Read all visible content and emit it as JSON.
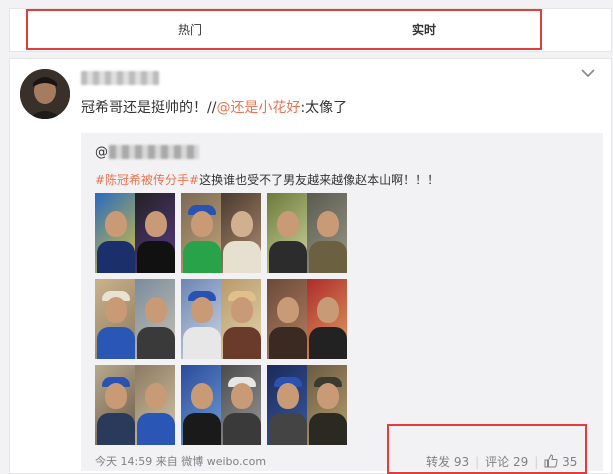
{
  "tabs": [
    {
      "label": "热门",
      "active": false
    },
    {
      "label": "实时",
      "active": true
    }
  ],
  "post": {
    "text_main": "冠希哥还是挺帅的！//",
    "mention": "@还是小花好",
    "text_after": ":太像了",
    "repost": {
      "user_prefix": "@",
      "hashtag": "#陈冠希被传分手#",
      "text": "这换谁也受不了男友越来越像赵本山啊！！！"
    },
    "footer": {
      "time": "今天 14:59",
      "source_prefix": "来自",
      "source": "微博 weibo.com"
    },
    "actions": {
      "repost_label": "转发",
      "repost_count": "93",
      "comment_label": "评论",
      "comment_count": "29",
      "like_count": "35"
    }
  },
  "colors": {
    "highlight_box": "#e23c3c",
    "link": "#eb7350"
  },
  "icons": [
    "chevron-down-icon",
    "like-icon"
  ]
}
